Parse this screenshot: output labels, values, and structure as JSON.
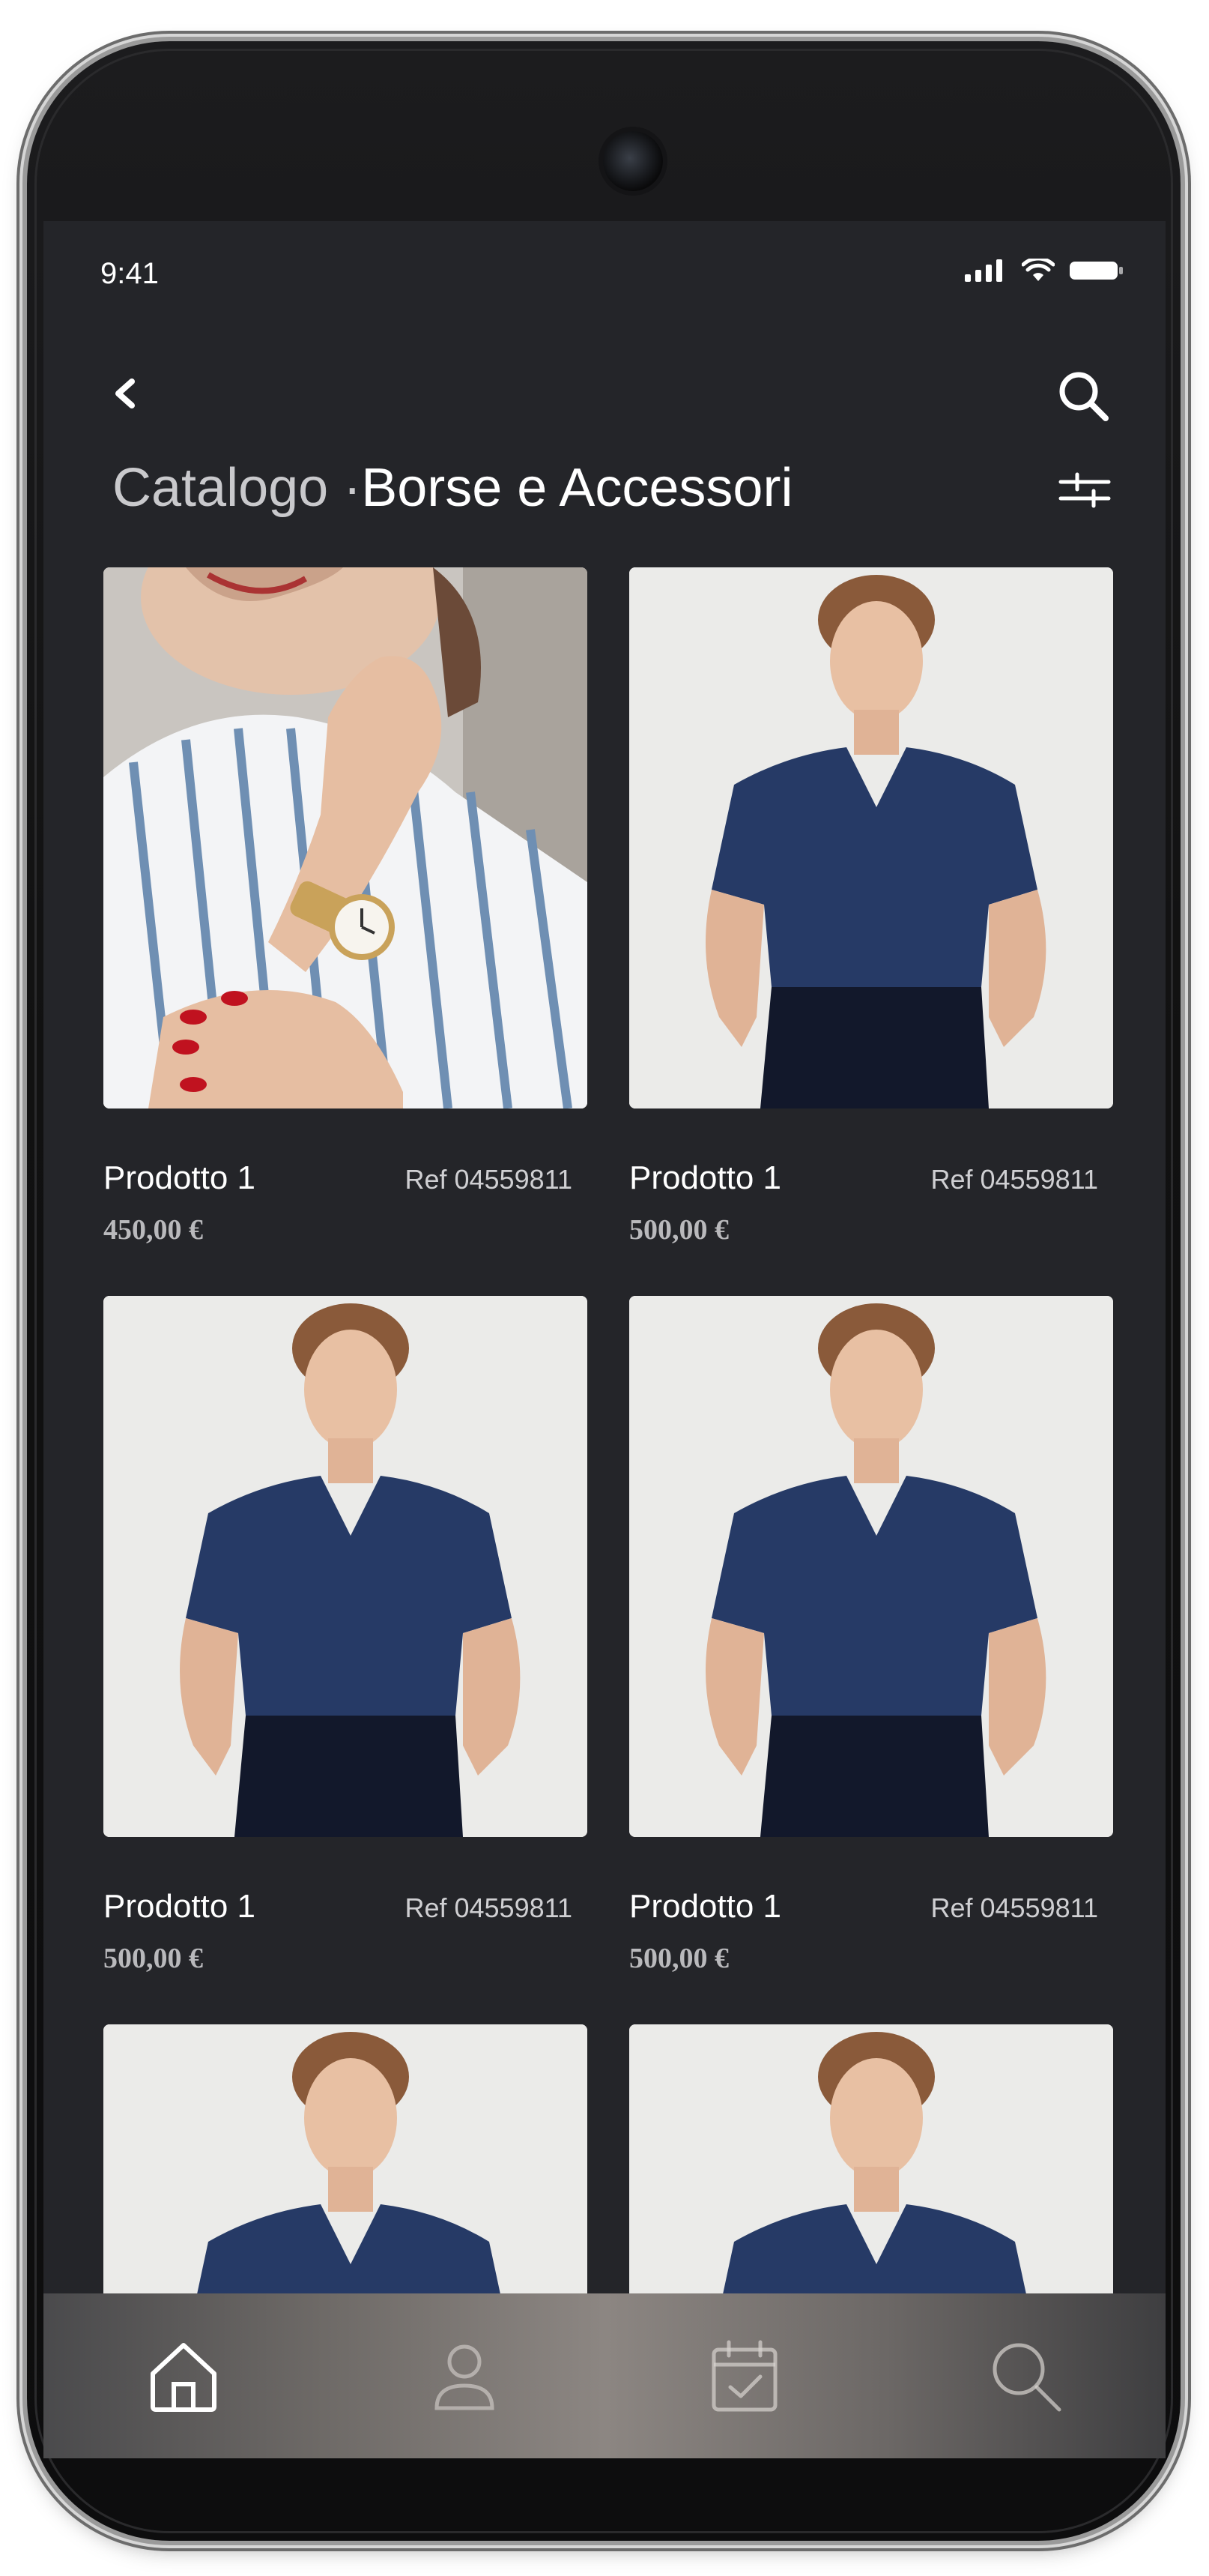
{
  "status_bar": {
    "time": "9:41"
  },
  "header": {
    "title_prefix": "Catalogo ·",
    "title_main": "Borse e Accessori"
  },
  "products": [
    {
      "name": "Prodotto 1",
      "ref": "Ref 04559811",
      "price": "450,00 €",
      "image": "woman-watch-photo"
    },
    {
      "name": "Prodotto 1",
      "ref": "Ref 04559811",
      "price": "500,00 €",
      "image": "woman-navy-blouse-photo"
    },
    {
      "name": "Prodotto 1",
      "ref": "Ref 04559811",
      "price": "500,00 €",
      "image": "woman-navy-blouse-photo"
    },
    {
      "name": "Prodotto 1",
      "ref": "Ref 04559811",
      "price": "500,00 €",
      "image": "woman-navy-blouse-photo"
    },
    {
      "name": "",
      "ref": "",
      "price": "",
      "image": "woman-navy-blouse-photo"
    },
    {
      "name": "",
      "ref": "",
      "price": "",
      "image": "woman-navy-blouse-photo"
    }
  ],
  "tabbar": {
    "items": [
      {
        "icon": "home-icon",
        "active": true
      },
      {
        "icon": "user-icon",
        "active": false
      },
      {
        "icon": "calendar-check-icon",
        "active": false
      },
      {
        "icon": "search-icon",
        "active": false
      }
    ]
  },
  "colors": {
    "screen_bg": "#242529",
    "text_primary": "#ffffff",
    "text_secondary": "#cfcfd2",
    "price": "#b9b9bc"
  }
}
